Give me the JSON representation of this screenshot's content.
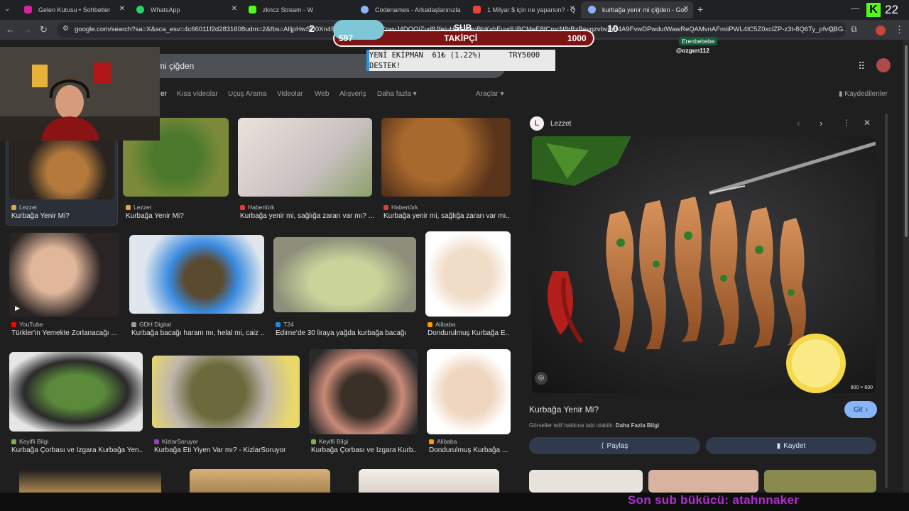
{
  "tabs": [
    {
      "title": "Gelen Kutusu • Sohbetler",
      "fav_color": "#d6249f"
    },
    {
      "title": "WhatsApp",
      "fav_color": "#25d366"
    },
    {
      "title": "zkncz Stream - W",
      "fav_color": "#53fc18"
    },
    {
      "title": "Codenames - Arkadaşlarınızla",
      "fav_color": "#8ab4f8"
    },
    {
      "title": "1 Milyar $ için ne yaparsın? - Q",
      "fav_color": "#ea4335"
    },
    {
      "title": "kurbağa yenir mi çiğden - Goo",
      "fav_color": "#8ab4f8"
    }
  ],
  "address": {
    "url": "google.com/search?sa=X&sca_esv=4c66011f2d2831608udm=2&fbs=AlljpHwSU0Xn4FRaYahfmc0Os-CrwyJ4DQOiZud8JfeiuHaGempBhKvhEuvdUBCMeE8fCmcN8rBzBeygzvbvmS4A9FvwDPwdutWawReQAMvnAFmiiPWL4lC5Z0xclZP-z3t-8Q6Ty_pfvOBG..."
  },
  "search": {
    "query": "mi çiğden",
    "chips": [
      "er",
      "Kısa videolar",
      "Uçuş Arama",
      "Videolar",
      "Web",
      "Alışveriş",
      "Daha fazla",
      "Araçlar"
    ],
    "saved_label": "Kaydedilenler"
  },
  "results": [
    {
      "source": "Lezzet",
      "caption": "Kurbağa Yenir Mi?",
      "src_color": "#e8a33a"
    },
    {
      "source": "Lezzet",
      "caption": "Kurbağa Yenir Mi?",
      "src_color": "#e8a33a"
    },
    {
      "source": "Habertürk",
      "caption": "Kurbağa yenir mi, sağlığa zararı var mı? ...",
      "src_color": "#e53935"
    },
    {
      "source": "Habertürk",
      "caption": "Kurbağa yenir mi, sağlığa zararı var mı...",
      "src_color": "#e53935"
    },
    {
      "source": "YouTube",
      "caption": "Türkler'in Yemekte Zorlanacağı ...",
      "src_color": "#ff0000"
    },
    {
      "source": "GDH Digital",
      "caption": "Kurbağa bacağı haram mı, helal mi, caiz ...",
      "src_color": "#9e9e9e"
    },
    {
      "source": "T24",
      "caption": "Edirne'de 30 liraya yağda kurbağa bacağı",
      "src_color": "#1e88e5"
    },
    {
      "source": "Alibaba",
      "caption": "Dondurulmuş Kurbağa E...",
      "src_color": "#ff9800"
    },
    {
      "source": "Keyifli Bilgi",
      "caption": "Kurbağa Çorbası ve Izgara Kurbağa Yen...",
      "src_color": "#7cb342"
    },
    {
      "source": "KizlarSoruyor",
      "caption": "Kurbağa Eti Yiyen Var mı? - KizlarSoruyor",
      "src_color": "#8e44ad"
    },
    {
      "source": "Keyifli Bilgi",
      "caption": "Kurbağa Çorbası ve Izgara Kurb...",
      "src_color": "#7cb342"
    },
    {
      "source": "Alibaba",
      "caption": "Dondurulmuş Kurbağa ...",
      "src_color": "#ff9800"
    }
  ],
  "panel": {
    "source": "Lezzet",
    "title": "Kurbağa Yenir Mi?",
    "dims": "800 × 600",
    "visit": "Git",
    "copyright_text": "Görseller telif hakkına tabi olabilir.",
    "more_info": "Daha Fazla Bilgi",
    "share": "Paylaş",
    "save": "Kaydet"
  },
  "overlay": {
    "goal_left": "2",
    "goal_sub": "SUB",
    "goal_right": "10",
    "followers_current": "597",
    "followers_label": "TAKİPÇİ",
    "followers_target": "1000",
    "ticker_line1": "YENİ EKİPMAN  61₺ (1.22%)      TRY5000",
    "ticker_line2": "DESTEK!",
    "chat_user": "Erenbebebe",
    "chat_user2": "@ozgun112",
    "k_count": "22",
    "last_sub": "Son sub bükücü: atahnnaker"
  }
}
